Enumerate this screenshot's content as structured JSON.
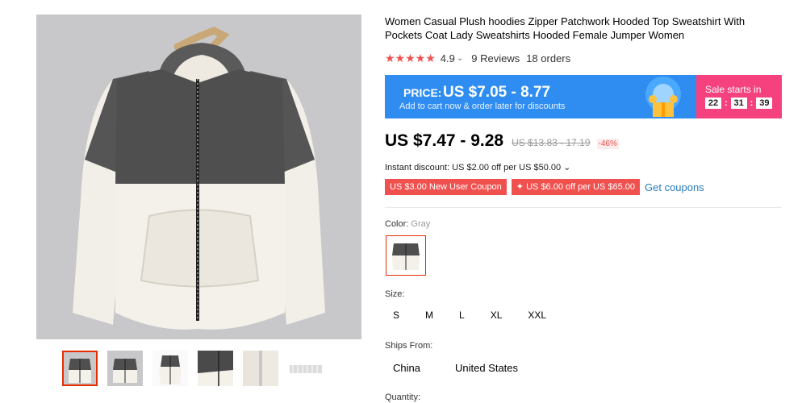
{
  "product": {
    "title": "Women Casual Plush hoodies Zipper Patchwork Hooded Top Sweatshirt With Pockets Coat Lady Sweatshirts Hooded Female Jumper Women"
  },
  "rating": {
    "stars": "★★★★★",
    "score": "4.9",
    "reviews": "9 Reviews",
    "orders": "18 orders"
  },
  "banner": {
    "price_label": "PRICE:",
    "price_value": "US $7.05 - 8.77",
    "subtitle": "Add to cart now & order later for discounts",
    "sale_label": "Sale starts in",
    "timer": [
      "22",
      "31",
      "39"
    ],
    "colors": {
      "blue": "#2f8df2",
      "pink": "#f5427f"
    }
  },
  "price": {
    "current": "US $7.47 - 9.28",
    "original": "US $13.83 - 17.19",
    "discount": "-46%"
  },
  "instant_discount": "Instant discount: US $2.00 off per US $50.00 ⌄",
  "coupons": {
    "new_user": "US $3.00 New User Coupon",
    "store": "✦ US $6.00 off per US $65.00",
    "get": "Get coupons"
  },
  "color": {
    "label": "Color:",
    "value": "Gray"
  },
  "size": {
    "label": "Size:",
    "options": [
      "S",
      "M",
      "L",
      "XL",
      "XXL"
    ]
  },
  "ships_from": {
    "label": "Ships From:",
    "options": [
      "China",
      "United States"
    ]
  },
  "quantity": {
    "label": "Quantity:"
  },
  "icons": [
    "star-icon",
    "chevron-down-icon",
    "gift-icon"
  ]
}
